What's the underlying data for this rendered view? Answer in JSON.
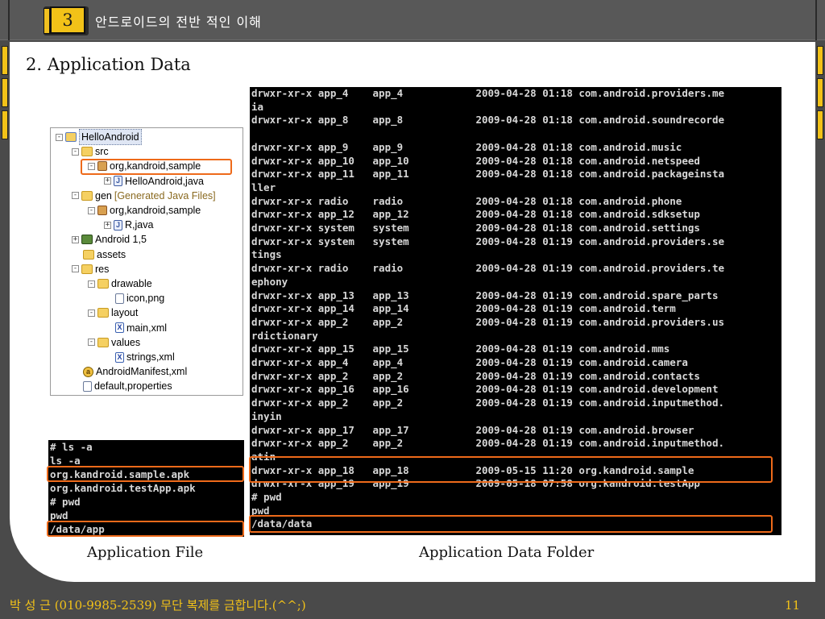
{
  "header": {
    "chapter_number": "3",
    "chapter_title": "안드로이드의 전반 적인 이해"
  },
  "slide": {
    "title": "2. Application Data"
  },
  "tree": [
    {
      "label": "HelloAndroid",
      "note": "",
      "icon": "project-icon",
      "expander": "-",
      "level": 0,
      "selected": true
    },
    {
      "label": "src",
      "note": "",
      "icon": "folder-icon",
      "expander": "-",
      "level": 1,
      "selected": false
    },
    {
      "label": "org,kandroid,sample",
      "note": "",
      "icon": "package-icon",
      "expander": "-",
      "level": 2,
      "selected": false
    },
    {
      "label": "HelloAndroid,java",
      "note": "",
      "icon": "java-file-icon",
      "expander": "+",
      "level": 3,
      "selected": false
    },
    {
      "label": "gen",
      "note": "[Generated Java Files]",
      "icon": "folder-icon",
      "expander": "-",
      "level": 1,
      "selected": false
    },
    {
      "label": "org,kandroid,sample",
      "note": "",
      "icon": "package-icon",
      "expander": "-",
      "level": 2,
      "selected": false
    },
    {
      "label": "R,java",
      "note": "",
      "icon": "java-file-icon",
      "expander": "+",
      "level": 3,
      "selected": false
    },
    {
      "label": "Android 1,5",
      "note": "",
      "icon": "library-icon",
      "expander": "+",
      "level": 1,
      "selected": false
    },
    {
      "label": "assets",
      "note": "",
      "icon": "folder-icon",
      "expander": "",
      "level": 1,
      "selected": false
    },
    {
      "label": "res",
      "note": "",
      "icon": "folder-icon",
      "expander": "-",
      "level": 1,
      "selected": false
    },
    {
      "label": "drawable",
      "note": "",
      "icon": "folder-icon",
      "expander": "-",
      "level": 2,
      "selected": false
    },
    {
      "label": "icon,png",
      "note": "",
      "icon": "file-icon",
      "expander": "",
      "level": 3,
      "selected": false
    },
    {
      "label": "layout",
      "note": "",
      "icon": "folder-icon",
      "expander": "-",
      "level": 2,
      "selected": false
    },
    {
      "label": "main,xml",
      "note": "",
      "icon": "xml-file-icon",
      "expander": "",
      "level": 3,
      "selected": false
    },
    {
      "label": "values",
      "note": "",
      "icon": "folder-icon",
      "expander": "-",
      "level": 2,
      "selected": false
    },
    {
      "label": "strings,xml",
      "note": "",
      "icon": "xml-file-icon",
      "expander": "",
      "level": 3,
      "selected": false
    },
    {
      "label": "AndroidManifest,xml",
      "note": "",
      "icon": "manifest-icon",
      "expander": "",
      "level": 1,
      "selected": false
    },
    {
      "label": "default,properties",
      "note": "",
      "icon": "file-icon",
      "expander": "",
      "level": 1,
      "selected": false
    }
  ],
  "terminal_small": {
    "lines": [
      "# ls -a",
      "ls -a",
      "org.kandroid.sample.apk",
      "org.kandroid.testApp.apk",
      "# pwd",
      "pwd",
      "/data/app"
    ]
  },
  "terminal_big": {
    "lines": [
      "drwxr-xr-x app_4    app_4            2009-04-28 01:18 com.android.providers.me",
      "ia",
      "drwxr-xr-x app_8    app_8            2009-04-28 01:18 com.android.soundrecorde",
      "",
      "drwxr-xr-x app_9    app_9            2009-04-28 01:18 com.android.music",
      "drwxr-xr-x app_10   app_10           2009-04-28 01:18 com.android.netspeed",
      "drwxr-xr-x app_11   app_11           2009-04-28 01:18 com.android.packageinsta",
      "ller",
      "drwxr-xr-x radio    radio            2009-04-28 01:18 com.android.phone",
      "drwxr-xr-x app_12   app_12           2009-04-28 01:18 com.android.sdksetup",
      "drwxr-xr-x system   system           2009-04-28 01:18 com.android.settings",
      "drwxr-xr-x system   system           2009-04-28 01:19 com.android.providers.se",
      "tings",
      "drwxr-xr-x radio    radio            2009-04-28 01:19 com.android.providers.te",
      "ephony",
      "drwxr-xr-x app_13   app_13           2009-04-28 01:19 com.android.spare_parts",
      "drwxr-xr-x app_14   app_14           2009-04-28 01:19 com.android.term",
      "drwxr-xr-x app_2    app_2            2009-04-28 01:19 com.android.providers.us",
      "rdictionary",
      "drwxr-xr-x app_15   app_15           2009-04-28 01:19 com.android.mms",
      "drwxr-xr-x app_4    app_4            2009-04-28 01:19 com.android.camera",
      "drwxr-xr-x app_2    app_2            2009-04-28 01:19 com.android.contacts",
      "drwxr-xr-x app_16   app_16           2009-04-28 01:19 com.android.development",
      "drwxr-xr-x app_2    app_2            2009-04-28 01:19 com.android.inputmethod.",
      "inyin",
      "drwxr-xr-x app_17   app_17           2009-04-28 01:19 com.android.browser",
      "drwxr-xr-x app_2    app_2            2009-04-28 01:19 com.android.inputmethod.",
      "atin",
      "drwxr-xr-x app_18   app_18           2009-05-15 11:20 org.kandroid.sample",
      "drwxr-xr-x app_19   app_19           2009-05-18 07:58 org.kandroid.testApp",
      "# pwd",
      "pwd",
      "/data/data"
    ]
  },
  "captions": {
    "left": "Application File",
    "right": "Application Data Folder"
  },
  "footer": {
    "author": "박 성 근 (010-9985-2539)  무단 복제를 금합니다.(^^;)",
    "page": "11"
  },
  "colors": {
    "accent": "#f2c218",
    "highlight": "#ee6a1a",
    "header_bg": "#585858",
    "frame_bg": "#4a4a4a"
  }
}
